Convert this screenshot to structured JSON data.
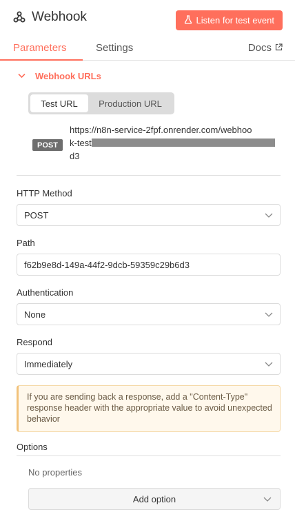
{
  "header": {
    "title": "Webhook",
    "listen_button": "Listen for test event",
    "tabs": [
      {
        "label": "Parameters",
        "active": true
      },
      {
        "label": "Settings",
        "active": false
      }
    ],
    "docs_label": "Docs"
  },
  "webhook_urls": {
    "section_label": "Webhook URLs",
    "toggle": [
      "Test URL",
      "Production URL"
    ],
    "selected": "Test URL",
    "method_badge": "POST",
    "url_line1": "https://n8n-service-2fpf.onrender.com/webhoo",
    "url_line2_prefix": "k-test",
    "url_line3": "d3"
  },
  "fields": {
    "http_method": {
      "label": "HTTP Method",
      "value": "POST"
    },
    "path": {
      "label": "Path",
      "value": "f62b9e8d-149a-44f2-9dcb-59359c29b6d3"
    },
    "authentication": {
      "label": "Authentication",
      "value": "None"
    },
    "respond": {
      "label": "Respond",
      "value": "Immediately"
    }
  },
  "notice": "If you are sending back a response, add a \"Content-Type\" response header with the appropriate value to avoid unexpected behavior",
  "options": {
    "label": "Options",
    "empty_text": "No properties",
    "add_button": "Add option"
  },
  "colors": {
    "accent": "#ff6f5c",
    "notice_bg": "#fff8ec",
    "badge_bg": "#6e6e6e"
  },
  "icons": {
    "title": "webhook-icon",
    "listen": "flask-icon",
    "docs": "external-link-icon",
    "section": "chevron-down-icon",
    "select": "chevron-down-icon"
  }
}
